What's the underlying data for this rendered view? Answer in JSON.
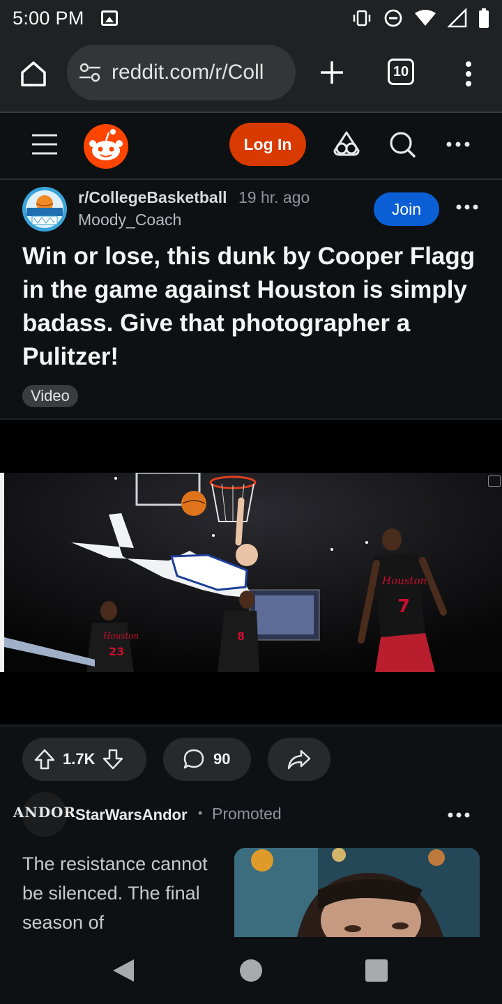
{
  "status_bar": {
    "time": "5:00 PM",
    "icons": [
      "image-notification-icon",
      "vibrate-icon",
      "do-not-disturb-icon",
      "wifi-icon",
      "signal-icon",
      "battery-icon"
    ]
  },
  "browser": {
    "url": "reddit.com/r/Coll",
    "tab_count": "10",
    "icons": [
      "home-icon",
      "site-settings-icon",
      "new-tab-icon",
      "tab-switcher-icon",
      "more-vert-icon"
    ]
  },
  "reddit_header": {
    "login_label": "Log In",
    "icons": [
      "menu-icon",
      "reddit-logo",
      "communities-icon",
      "search-icon",
      "more-horiz-icon"
    ],
    "accent": "#d93a00"
  },
  "post": {
    "subreddit": "r/CollegeBasketball",
    "time_ago": "19 hr. ago",
    "author": "Moody_Coach",
    "join_label": "Join",
    "title": "Win or lose, this dunk by Cooper Flagg in the game against Houston is simply badass. Give that photographer a Pulitzer!",
    "flair": "Video",
    "upvotes": "1.7K",
    "comments": "90",
    "join_color": "#0b5fd4"
  },
  "promoted": {
    "advertiser": "StarWarsAndor",
    "avatar_text": "ANDOR",
    "label": "Promoted",
    "text": "The resistance cannot be silenced. The final season of"
  },
  "nav_bar": {
    "icons": [
      "back-icon",
      "home-nav-icon",
      "recents-icon"
    ]
  }
}
